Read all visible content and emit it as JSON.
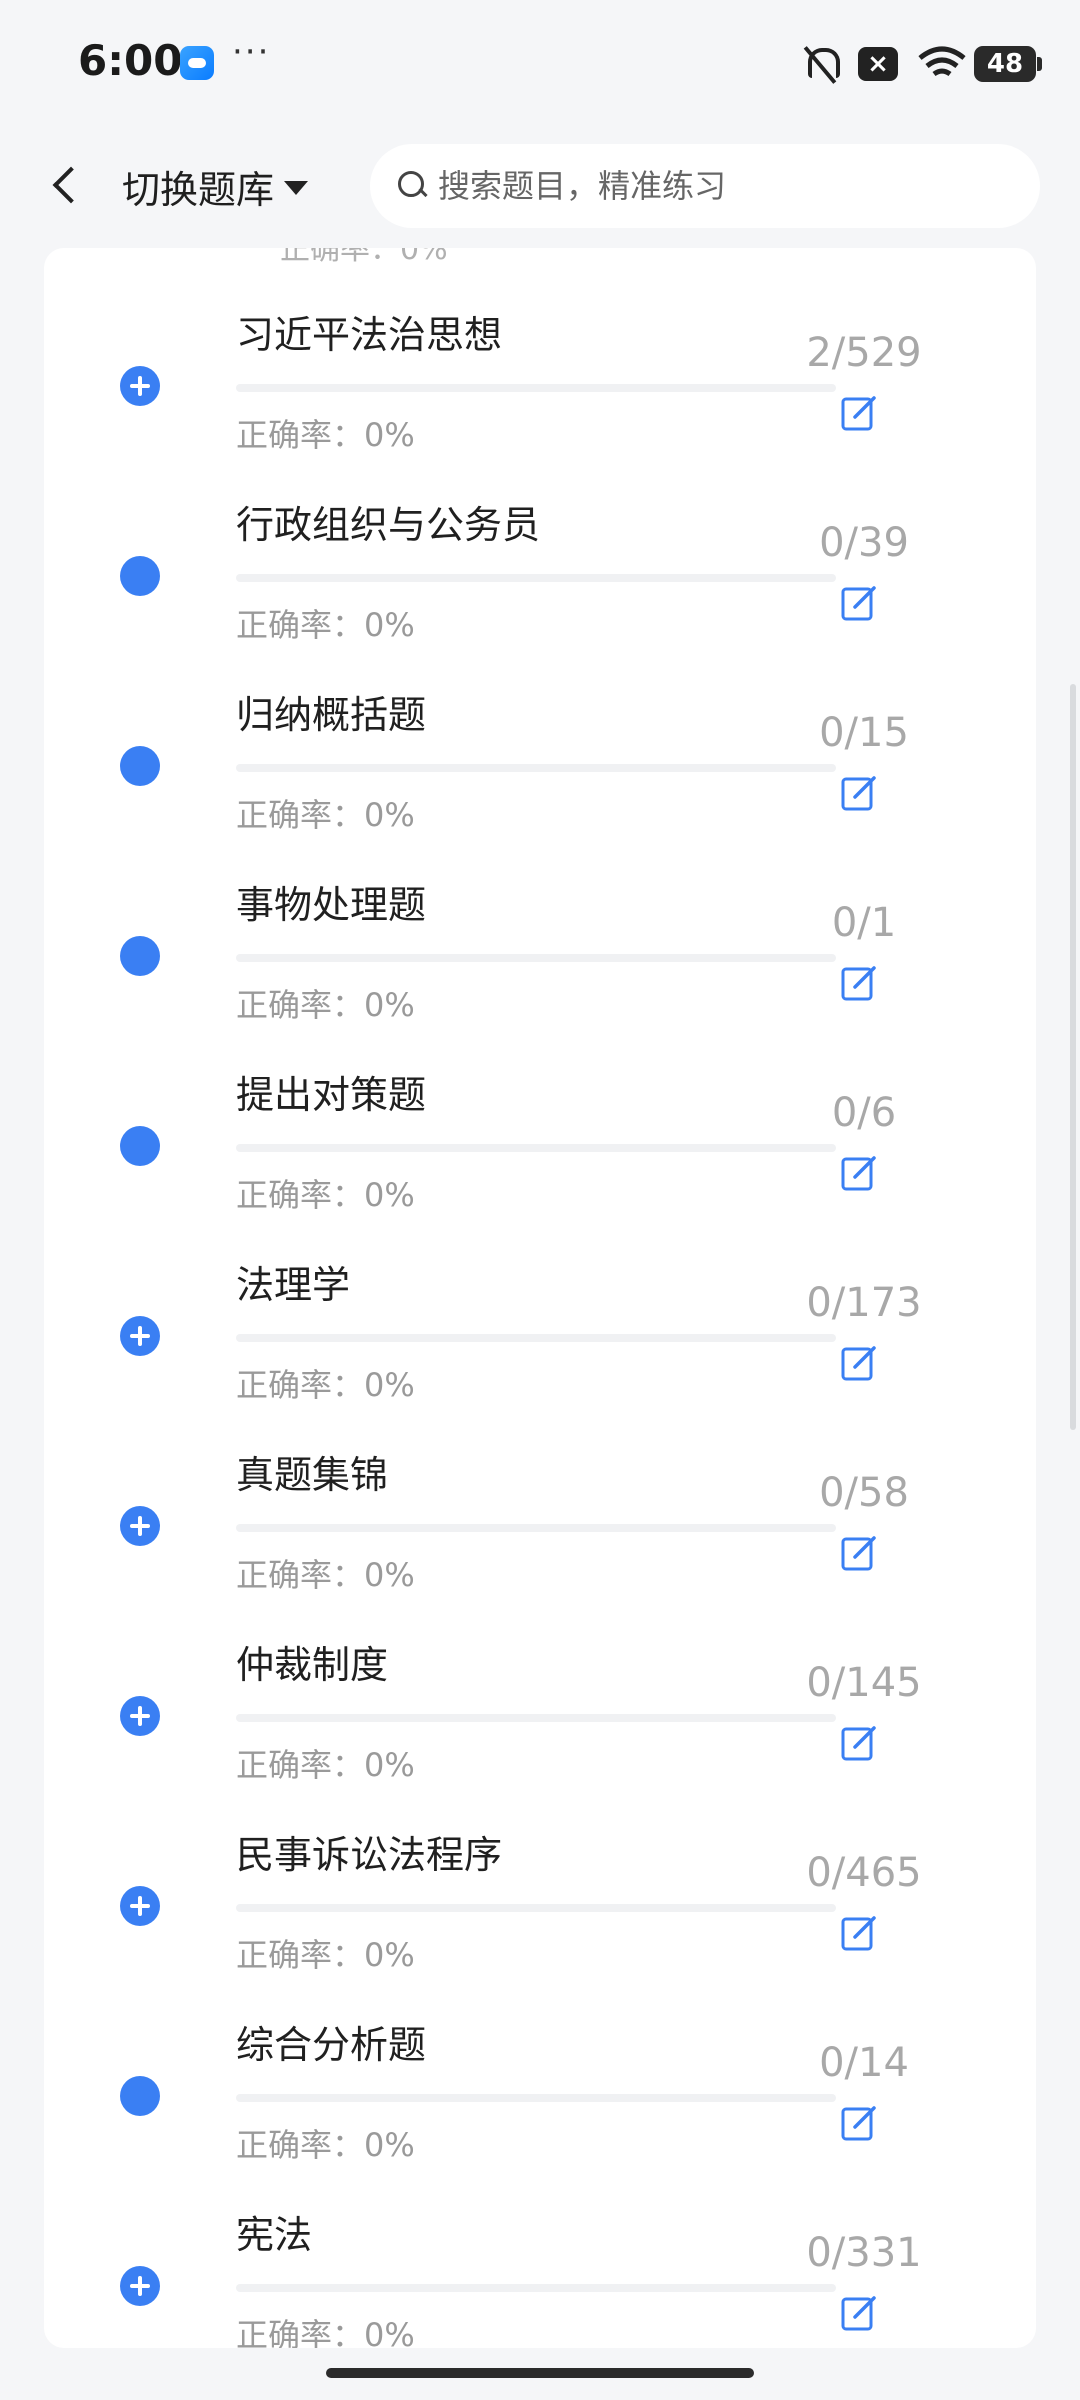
{
  "status_bar": {
    "time": "6:00",
    "dots": "···",
    "battery": "48",
    "icons": [
      "weather-app-icon",
      "bell-off-icon",
      "close-box-icon",
      "wifi-icon",
      "battery-icon"
    ]
  },
  "header": {
    "switch_label": "切换题库",
    "search_placeholder": "搜索题目，精准练习"
  },
  "list": {
    "prev_peek": "正确率：0%",
    "items": [
      {
        "title": "习近平法治思想",
        "rate": "正确率：0%",
        "count": "2/529",
        "icon": "plus-circle"
      },
      {
        "title": "行政组织与公务员",
        "rate": "正确率：0%",
        "count": "0/39",
        "icon": "dot"
      },
      {
        "title": "归纳概括题",
        "rate": "正确率：0%",
        "count": "0/15",
        "icon": "dot"
      },
      {
        "title": "事物处理题",
        "rate": "正确率：0%",
        "count": "0/1",
        "icon": "dot"
      },
      {
        "title": "提出对策题",
        "rate": "正确率：0%",
        "count": "0/6",
        "icon": "dot"
      },
      {
        "title": "法理学",
        "rate": "正确率：0%",
        "count": "0/173",
        "icon": "plus-circle"
      },
      {
        "title": "真题集锦",
        "rate": "正确率：0%",
        "count": "0/58",
        "icon": "plus-circle"
      },
      {
        "title": "仲裁制度",
        "rate": "正确率：0%",
        "count": "0/145",
        "icon": "plus-circle"
      },
      {
        "title": "民事诉讼法程序",
        "rate": "正确率：0%",
        "count": "0/465",
        "icon": "plus-circle"
      },
      {
        "title": "综合分析题",
        "rate": "正确率：0%",
        "count": "0/14",
        "icon": "dot"
      },
      {
        "title": "宪法",
        "rate": "正确率：0%",
        "count": "0/331",
        "icon": "plus-circle"
      }
    ]
  },
  "colors": {
    "accent": "#3a7ff3",
    "bg": "#f5f6f8"
  }
}
